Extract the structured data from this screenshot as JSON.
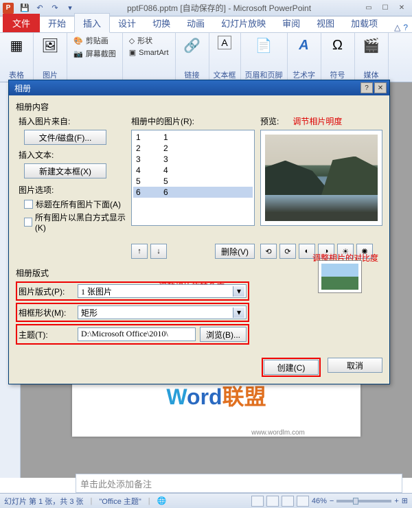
{
  "titlebar": {
    "app_icon_letter": "P",
    "title": "pptF086.pptm [自动保存的] - Microsoft PowerPoint"
  },
  "ribbon_tabs": {
    "file": "文件",
    "tabs": [
      "开始",
      "插入",
      "设计",
      "切换",
      "动画",
      "幻灯片放映",
      "审阅",
      "视图",
      "加载项"
    ],
    "active_index": 1
  },
  "ribbon": {
    "groups": {
      "tables": "表格",
      "images": "图片",
      "clipart": "剪贴画",
      "screenshot": "屏幕截图",
      "shapes": "形状",
      "smartart": "SmartArt",
      "links": "链接",
      "textbox": "文本框",
      "headerfooter": "页眉和页脚",
      "wordart": "艺术字",
      "symbols": "符号",
      "media": "媒体"
    }
  },
  "dialog": {
    "title": "相册",
    "content_label": "相册内容",
    "insert_from": "插入图片来自:",
    "file_disk_btn": "文件/磁盘(F)...",
    "insert_text": "插入文本:",
    "new_textbox_btn": "新建文本框(X)",
    "pic_options": "图片选项:",
    "caption_chk": "标题在所有图片下面(A)",
    "bw_chk": "所有图片以黑白方式显示(K)",
    "pics_in_album": "相册中的图片(R):",
    "preview_label": "预览:",
    "list_items": [
      {
        "n": "1",
        "name": "1"
      },
      {
        "n": "2",
        "name": "2"
      },
      {
        "n": "3",
        "name": "3"
      },
      {
        "n": "4",
        "name": "4"
      },
      {
        "n": "5",
        "name": "5"
      },
      {
        "n": "6",
        "name": "6"
      }
    ],
    "selected_index": 5,
    "delete_btn": "删除(V)",
    "layout_label": "相册版式",
    "pic_layout_lbl": "图片版式(P):",
    "pic_layout_val": "1 张图片",
    "frame_shape_lbl": "相框形状(M):",
    "frame_shape_val": "矩形",
    "theme_lbl": "主题(T):",
    "theme_val": "D:\\Microsoft Office\\2010\\",
    "browse_btn": "浏览(B)...",
    "create_btn": "创建(C)",
    "cancel_btn": "取消",
    "annotations": {
      "brightness": "调节相片明度",
      "rotation": "调整相片旋转角度",
      "contrast": "调整相片的对比度"
    }
  },
  "slide": {
    "logo_url": "www.wordlm.com"
  },
  "notes": {
    "placeholder": "单击此处添加备注"
  },
  "statusbar": {
    "slide_info": "幻灯片 第 1 张，共 3 张",
    "theme": "\"Office 主题\"",
    "lang": "",
    "zoom": "46%"
  }
}
